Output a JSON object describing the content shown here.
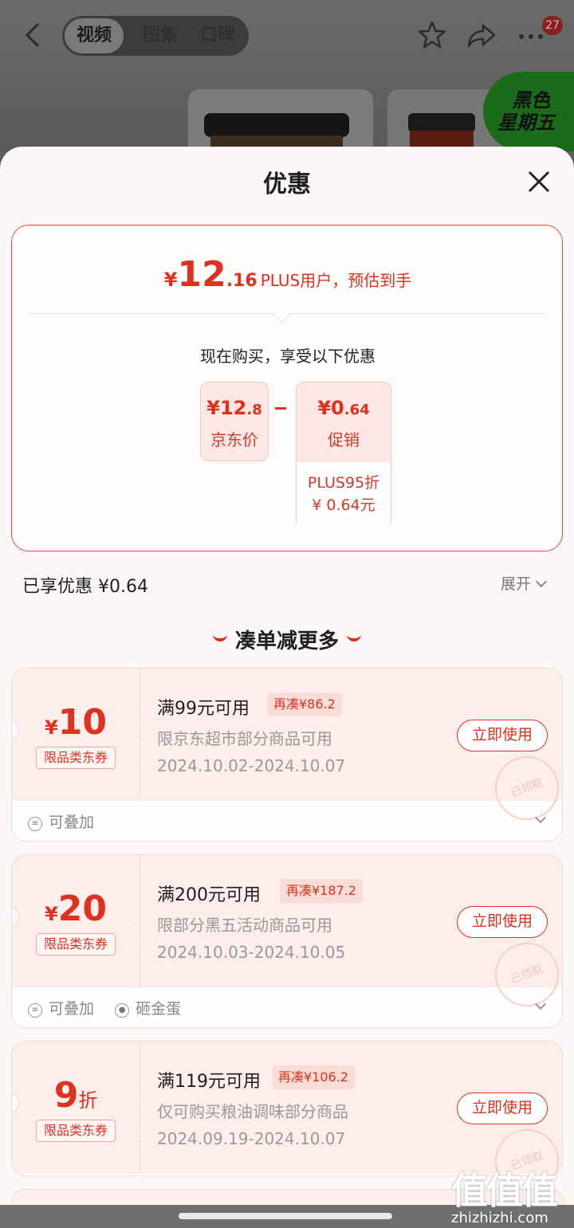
{
  "header": {
    "tabs": [
      "视频",
      "图集",
      "口碑"
    ],
    "active_tab": "视频",
    "notification_count": "27",
    "promo_badge": [
      "黑色",
      "星期五"
    ]
  },
  "sheet": {
    "title": "优惠",
    "estimate": {
      "currency": "¥",
      "integer": "12",
      "decimal": ".16",
      "label": "PLUS用户，预估到手"
    },
    "subhead": "现在购买，享受以下优惠",
    "jd_price": {
      "currency": "¥",
      "value": "12.8",
      "integer": "12",
      "decimal": ".8",
      "label": "京东价"
    },
    "promo": {
      "currency": "¥",
      "integer": "0",
      "decimal": ".64",
      "label": "促销",
      "detail_line1": "PLUS95折",
      "detail_line2": "¥ 0.64元"
    },
    "enjoyed": "已享优惠 ¥0.64",
    "expand_label": "展开",
    "more_title": "凑单减更多"
  },
  "coupons": [
    {
      "symbol": "¥",
      "amount": "10",
      "unit": "",
      "tag": "限品类东券",
      "condition": "满99元可用",
      "need_more": "再凑¥86.2",
      "description": "限京东超市部分商品可用",
      "dates": "2024.10.02-2024.10.07",
      "button": "立即使用",
      "stamp": "已领取",
      "features": [
        "可叠加"
      ]
    },
    {
      "symbol": "¥",
      "amount": "20",
      "unit": "",
      "tag": "限品类东券",
      "condition": "满200元可用",
      "need_more": "再凑¥187.2",
      "description": "限部分黑五活动商品可用",
      "dates": "2024.10.03-2024.10.05",
      "button": "立即使用",
      "stamp": "已领取",
      "features": [
        "可叠加",
        "砸金蛋"
      ]
    },
    {
      "symbol": "",
      "amount": "9",
      "unit": "折",
      "tag": "限品类东券",
      "condition": "满119元可用",
      "need_more": "再凑¥106.2",
      "description": "仅可购买粮油调味部分商品",
      "dates": "2024.09.19-2024.10.07",
      "button": "立即使用",
      "stamp": "已领取",
      "features": []
    }
  ],
  "watermark": {
    "logo": "值值值",
    "site": "zhizhizhi.com"
  },
  "colors": {
    "accent": "#e0301e",
    "sheet_bg": "#fcf8f7",
    "coupon_bg": "#fdeeeb"
  }
}
